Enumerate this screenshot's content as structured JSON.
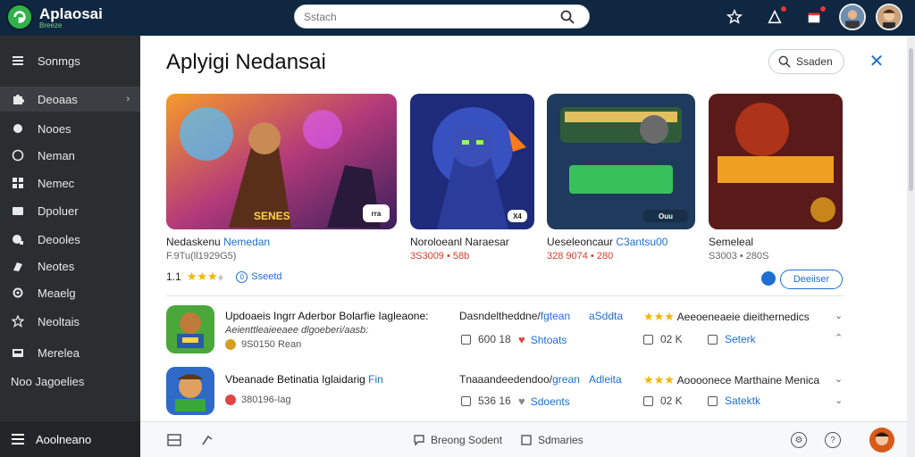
{
  "app": {
    "title": "Aplaosai",
    "subtitle": "Breeze"
  },
  "search": {
    "placeholder": "Sstach"
  },
  "sidebar": {
    "items": [
      {
        "label": "Sonmgs",
        "icon": "list-icon"
      },
      {
        "label": "Deoaas",
        "icon": "puzzle-icon",
        "active": true
      },
      {
        "label": "Nooes",
        "icon": "gamepad-icon"
      },
      {
        "label": "Neman",
        "icon": "shield-icon"
      },
      {
        "label": "Nemec",
        "icon": "grid-icon"
      },
      {
        "label": "Dpoluer",
        "icon": "download-icon"
      },
      {
        "label": "Deooles",
        "icon": "chart-icon"
      },
      {
        "label": "Neotes",
        "icon": "note-icon"
      },
      {
        "label": "Meaelg",
        "icon": "settings-icon"
      },
      {
        "label": "Neoltais",
        "icon": "star-icon"
      },
      {
        "label": "Merelea",
        "icon": "inbox-icon"
      }
    ],
    "plain_item": "Noo Jagoelies",
    "bottom_label": "Aoolneano"
  },
  "main": {
    "title": "Aplyigi Nedansai",
    "sort_label": "Ssaden",
    "cards": [
      {
        "badge": "SENES",
        "corner": "rra",
        "title": "Nedaskenu",
        "title_hl": "Nemedan",
        "meta": "F.9Tu(ll1929G5)",
        "meta_red": false
      },
      {
        "badge": "",
        "corner": "X4",
        "title": "Noroloeanl",
        "title_hl": "Naraesar",
        "meta": "3S3009 • 58b",
        "meta_red": true
      },
      {
        "badge": "",
        "corner": "Ouu",
        "title": "Ueseleoncaur",
        "title_hl": "C3antsu00",
        "meta": "328 9074 • 280",
        "meta_red": true
      },
      {
        "badge": "",
        "corner": "",
        "title": "Semeleal",
        "title_hl": "",
        "meta": "S3003 • 280S",
        "meta_red": false
      }
    ],
    "rating": {
      "value": "1.1",
      "link_label": "Sseetd",
      "link_badge": "0"
    },
    "action_button": "Deeiiser",
    "rows": [
      {
        "title": "Updoaeis Ingrr Aderbor Bolarfie Iagleaone:",
        "subtitle": "Aeienttleaieeaee dlgoeberi/aasb:",
        "meta": "9S0150 Rean",
        "col2": "Dasndeltheddne/",
        "col2_hl": "fgtean",
        "col2_link": "aSddta",
        "col3": "Aeeoeneaeie dieithernedics",
        "stat1": "600 18",
        "stat2": "Shtoats",
        "stat3": "02 K",
        "stat4": "Seterk"
      },
      {
        "title": "Vbeanade Betinatia Iglaidarig",
        "title_hl": "Fin",
        "subtitle": "",
        "meta": "380196-Iag",
        "col2": "Tnaaandeedendoo/",
        "col2_hl": "grean",
        "col2_link": "Adleita",
        "col3": "Aoooonece Marthaine Menica",
        "stat1": "536 16",
        "stat2": "Sdoents",
        "stat3": "02 K",
        "stat4": "Satektk"
      }
    ]
  },
  "footer": {
    "center_label": "Breong Sodent",
    "center2_label": "Sdmaries"
  },
  "colors": {
    "topbar": "#0f2740",
    "sidebar": "#2b2e31",
    "accent": "#1d6fd1",
    "star": "#f4b400"
  }
}
